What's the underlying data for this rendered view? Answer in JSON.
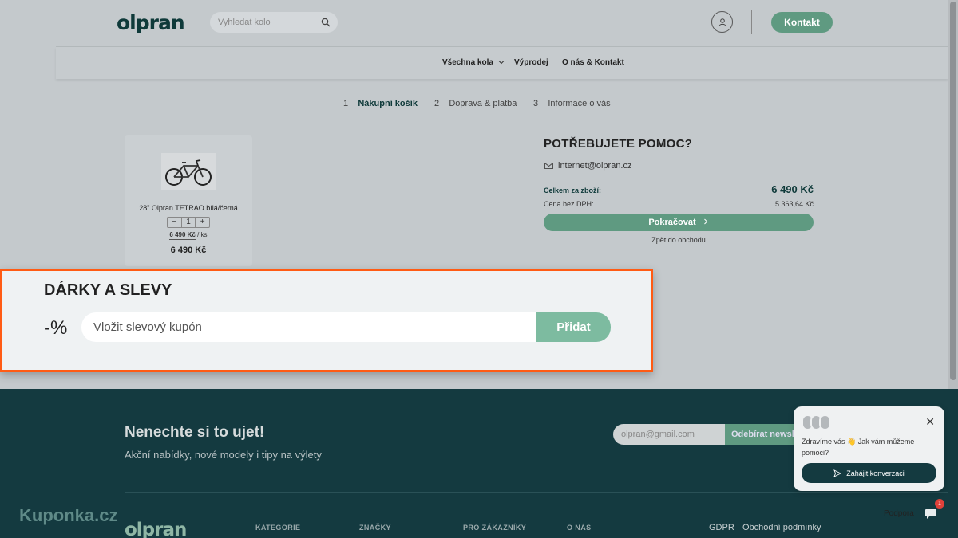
{
  "header": {
    "logo": "olpran",
    "search_placeholder": "Vyhledat kolo",
    "contact_label": "Kontakt"
  },
  "nav": {
    "items": [
      {
        "label": "Všechna kola"
      },
      {
        "label": "Výprodej"
      },
      {
        "label": "O nás & Kontakt"
      }
    ]
  },
  "steps": [
    {
      "num": "1",
      "label": "Nákupní košík"
    },
    {
      "num": "2",
      "label": "Doprava & platba"
    },
    {
      "num": "3",
      "label": "Informace o vás"
    }
  ],
  "cart_item": {
    "name": "28\" Olpran TETRAO bílá/černá",
    "qty_minus": "−",
    "qty": "1",
    "qty_plus": "+",
    "unit_price": "6 490 Kč",
    "unit_suffix": " / ks",
    "total": "6 490 Kč"
  },
  "help": {
    "title": "POTŘEBUJETE POMOC?",
    "email": "internet@olpran.cz"
  },
  "summary": {
    "total_label": "Celkem za zboží:",
    "total_value": "6 490 Kč",
    "net_label": "Cena bez DPH:",
    "net_value": "5 363,64 Kč",
    "continue_label": "Pokračovat",
    "back_label": "Zpět do obchodu"
  },
  "discount": {
    "title": "DÁRKY A SLEVY",
    "icon_text": "-%",
    "placeholder": "Vložit slevový kupón",
    "button_label": "Přidat",
    "highlight_color": "#ff5b14"
  },
  "footer": {
    "newsletter_title": "Nenechte si to ujet!",
    "newsletter_sub": "Akční nabídky, nové modely i tipy na výlety",
    "email_placeholder": "olpran@gmail.com",
    "subscribe_label": "Odebírat newsletter",
    "logo": "olpran",
    "columns": [
      "KATEGORIE",
      "ZNAČKY",
      "PRO ZÁKAZNÍKY",
      "O NÁS"
    ],
    "links": [
      "GDPR",
      "Obchodní podmínky"
    ],
    "watermark": "Kuponka.cz"
  },
  "chat": {
    "greeting": "Zdravíme vás 👋 Jak vám můžeme pomoci?",
    "start_label": "Zahájit konverzaci",
    "support_label": "Podpora",
    "badge": "1"
  }
}
